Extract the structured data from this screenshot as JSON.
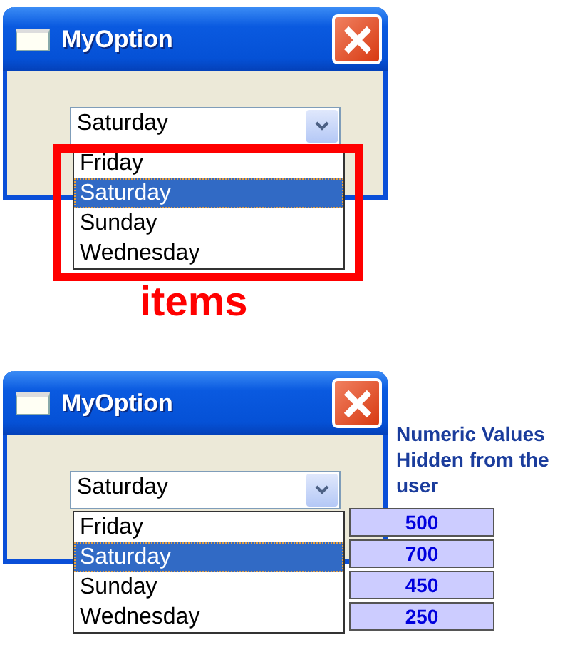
{
  "figures": [
    {
      "window": {
        "title": "MyOption"
      },
      "combo": {
        "value": "Saturday"
      },
      "items": [
        {
          "label": "Friday",
          "selected": false
        },
        {
          "label": "Saturday",
          "selected": true
        },
        {
          "label": "Sunday",
          "selected": false
        },
        {
          "label": "Wednesday",
          "selected": false
        }
      ],
      "annotation": {
        "kind": "frame",
        "label": "items"
      }
    },
    {
      "window": {
        "title": "MyOption"
      },
      "combo": {
        "value": "Saturday"
      },
      "items": [
        {
          "label": "Friday",
          "selected": false,
          "value": "500"
        },
        {
          "label": "Saturday",
          "selected": true,
          "value": "700"
        },
        {
          "label": "Sunday",
          "selected": false,
          "value": "450"
        },
        {
          "label": "Wednesday",
          "selected": false,
          "value": "250"
        }
      ],
      "annotation": {
        "kind": "values",
        "label": "Numeric Values Hidden from the user"
      }
    }
  ]
}
